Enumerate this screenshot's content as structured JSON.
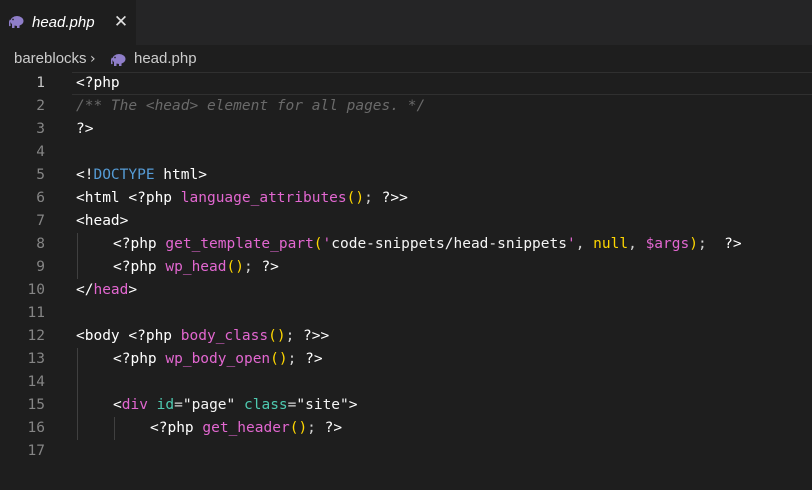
{
  "tab": {
    "title": "head.php",
    "close_glyph": "✕",
    "icon": "php-elephant-icon",
    "active": true
  },
  "breadcrumb": {
    "folder": "bareblocks",
    "separator": "›",
    "file": "head.php",
    "file_icon": "php-elephant-icon"
  },
  "editor": {
    "current_line": 1,
    "line_numbers": [
      "1",
      "2",
      "3",
      "4",
      "5",
      "6",
      "7",
      "8",
      "9",
      "10",
      "11",
      "12",
      "13",
      "14",
      "15",
      "16",
      "17"
    ],
    "lines": {
      "l1": {
        "open": "<",
        "php": "?php"
      },
      "l2": {
        "comment": "/** The <head> element for all pages. */"
      },
      "l3": {
        "close": "?>"
      },
      "l5": {
        "lt": "<",
        "bang": "!",
        "doctype": "DOCTYPE",
        "html": " html",
        "gt": ">"
      },
      "l6": {
        "open": "<html ",
        "php": "<?php ",
        "fn": "language_attributes",
        "p_open": "(",
        "p_close": ")",
        "semi": "; ",
        "end": "?>",
        "gt": ">"
      },
      "l7": {
        "tag": "<head>"
      },
      "l8": {
        "php": "<?php ",
        "fn": "get_template_part",
        "p_open": "(",
        "q1": "'",
        "str": "code-snippets/head-snippets",
        "q2": "'",
        "comma1": ", ",
        "null": "null",
        "comma2": ", ",
        "var": "$args",
        "p_close": ")",
        "semi": ";  ",
        "end": "?>"
      },
      "l9": {
        "php": "<?php ",
        "fn": "wp_head",
        "p_open": "(",
        "p_close": ")",
        "semi": "; ",
        "end": "?>"
      },
      "l10": {
        "lt": "</",
        "tag": "head",
        "gt": ">"
      },
      "l12": {
        "open": "<body ",
        "php": "<?php ",
        "fn": "body_class",
        "p_open": "(",
        "p_close": ")",
        "semi": "; ",
        "end": "?>",
        "gt": ">"
      },
      "l13": {
        "php": "<?php ",
        "fn": "wp_body_open",
        "p_open": "(",
        "p_close": ")",
        "semi": "; ",
        "end": "?>"
      },
      "l15": {
        "lt": "<",
        "tag": "div",
        "sp1": " ",
        "attr1": "id",
        "eq1": "=",
        "val1": "\"page\"",
        "sp2": " ",
        "attr2": "class",
        "eq2": "=",
        "val2": "\"site\"",
        "gt": ">"
      },
      "l16": {
        "php": "<?php ",
        "fn": "get_header",
        "p_open": "(",
        "p_close": ")",
        "semi": "; ",
        "end": "?>"
      }
    }
  },
  "colors": {
    "background": "#1e1e1e",
    "tabbar": "#252526",
    "comment": "#6a6a6a",
    "function": "#e267d0",
    "paren": "#ffd700",
    "keyword": "#569cd6",
    "attribute": "#4ec9b0"
  }
}
